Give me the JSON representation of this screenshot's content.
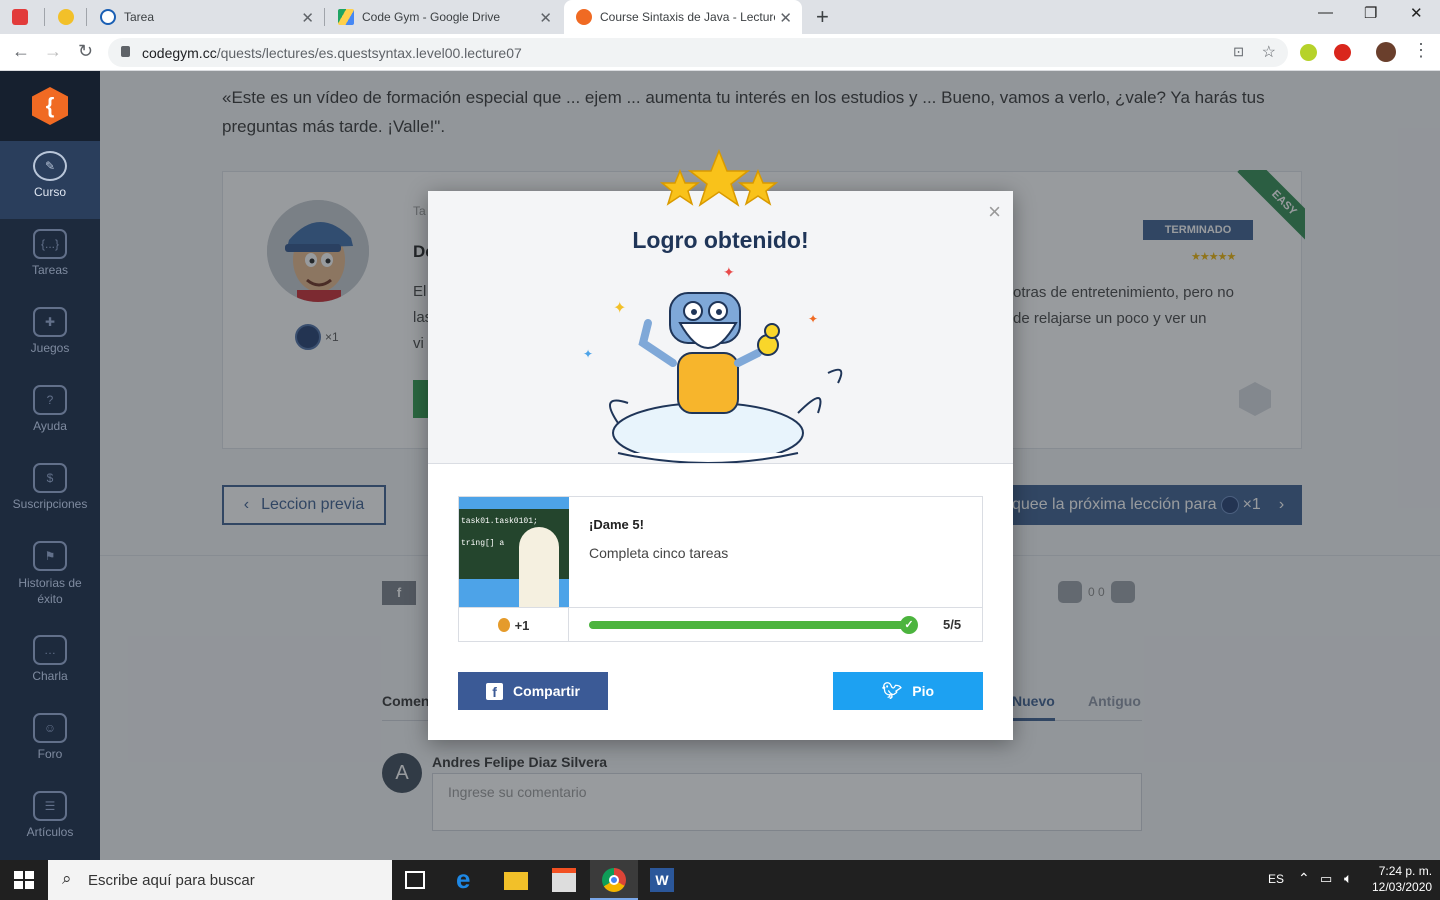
{
  "browser": {
    "tabs": [
      {
        "label": "",
        "icon": "pin-icon"
      },
      {
        "label": "",
        "icon": "app-icon"
      },
      {
        "label": "Tarea"
      },
      {
        "label": "Code Gym - Google Drive"
      },
      {
        "label": "Course Sintaxis de Java - Lecture"
      }
    ],
    "new_tab": "+",
    "url_host": "codegym.cc",
    "url_path": "/quests/lectures/es.questsyntax.level00.lecture07",
    "controls": {
      "min": "—",
      "max": "❐",
      "close": "✕"
    }
  },
  "sidebar": {
    "logo": "{",
    "items": [
      {
        "label": "Curso",
        "icon": "rocket-icon"
      },
      {
        "label": "Tareas",
        "icon": "code-braces-icon"
      },
      {
        "label": "Juegos",
        "icon": "gamepad-icon"
      },
      {
        "label": "Ayuda",
        "icon": "help-icon"
      },
      {
        "label": "Suscripciones",
        "icon": "dollar-icon"
      },
      {
        "label": "Historias de éxito",
        "icon": "flag-icon"
      },
      {
        "label": "Charla",
        "icon": "chat-icon"
      },
      {
        "label": "Foro",
        "icon": "forum-icon"
      },
      {
        "label": "Artículos",
        "icon": "articles-icon"
      }
    ]
  },
  "lecture": {
    "intro": "«Este es un vídeo de formación especial que ... ejem ... aumenta tu interés en los estudios y ... Bueno, vamos a verlo, ¿vale? Ya harás tus preguntas más tarde. ¡Valle!\".",
    "badge_count": "×1",
    "status": "TERMINADO",
    "rating": "★★★★★",
    "difficulty": "EASY",
    "frag_ta": "Ta",
    "frag_de": "De",
    "frag_el": "El",
    "frag_las": "las",
    "frag_vi": "vi",
    "text_right_1": "otras de entretenimiento, pero no",
    "text_right_2": "de relajarse un poco y ver un",
    "prev_button": "Leccion previa",
    "next_button": "quee la próxima lección para",
    "next_count": "×1"
  },
  "social": {
    "fb": "f",
    "likes": "0 0"
  },
  "comments": {
    "tab_left": "Comen",
    "tab_new": "Nuevo",
    "tab_old": "Antiguo",
    "user_initial": "A",
    "user_name": "Andres Felipe Diaz Silvera",
    "placeholder": "Ingrese su comentario"
  },
  "modal": {
    "title": "Logro obtenido!",
    "close": "×",
    "achievement_name": "¡Dame 5!",
    "achievement_desc": "Completa cinco tareas",
    "chalk_text": "task01.task0101;",
    "chalk_text2": "tring[] a",
    "reward": "+1",
    "progress_text": "5/5",
    "progress_fraction": 1.0,
    "share_facebook": "Compartir",
    "share_twitter": "Pio",
    "colors": {
      "title": "#1f3558",
      "progress": "#4cb43e",
      "facebook": "#3b5a96",
      "twitter": "#1da1f2"
    }
  },
  "taskbar": {
    "search_placeholder": "Escribe aquí para buscar",
    "lang": "ES",
    "time": "7:24 p. m.",
    "date": "12/03/2020"
  }
}
